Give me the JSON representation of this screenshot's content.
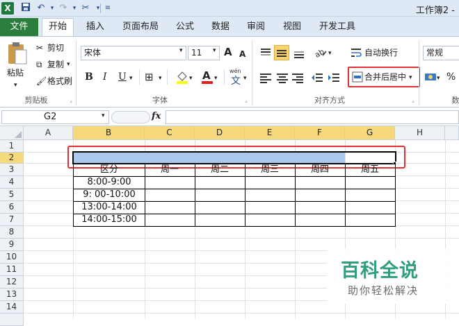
{
  "window": {
    "title": "工作簿2 -"
  },
  "quick_access": {
    "icons": [
      "excel-icon",
      "save-icon",
      "undo-icon",
      "redo-icon",
      "tools-icon"
    ]
  },
  "tabs": [
    {
      "label": "文件"
    },
    {
      "label": "开始"
    },
    {
      "label": "插入"
    },
    {
      "label": "页面布局"
    },
    {
      "label": "公式"
    },
    {
      "label": "数据"
    },
    {
      "label": "审阅"
    },
    {
      "label": "视图"
    },
    {
      "label": "开发工具"
    }
  ],
  "ribbon": {
    "clipboard": {
      "paste": "粘贴",
      "cut": "剪切",
      "copy": "复制",
      "format_painter": "格式刷",
      "label": "剪贴板"
    },
    "font": {
      "name": "宋体",
      "size": "11",
      "bold": "B",
      "italic": "I",
      "underline": "U",
      "grow": "A",
      "shrink": "A",
      "wen": "wén",
      "wen_char": "文",
      "label": "字体",
      "font_color_letter": "A"
    },
    "alignment": {
      "wrap_text": "自动换行",
      "merge_center": "合并后居中",
      "label": "对齐方式"
    },
    "number": {
      "format": "常规",
      "label": "数",
      "percent": "%"
    }
  },
  "formula_bar": {
    "name_box": "G2",
    "fx": "fx",
    "content": ""
  },
  "grid": {
    "columns": [
      "A",
      "B",
      "C",
      "D",
      "E",
      "F",
      "G",
      "H"
    ],
    "rows": [
      "1",
      "2",
      "3",
      "4",
      "5",
      "6",
      "7",
      "8",
      "9",
      "10",
      "11",
      "12",
      "13",
      "14"
    ],
    "header_row": [
      "区分",
      "周一",
      "周二",
      "周三",
      "周四",
      "周五"
    ],
    "time_slots": [
      "8:00-9:00",
      "9: 00-10:00",
      "13:00-14:00",
      "14:00-15:00"
    ]
  },
  "watermark": {
    "title": "百科全说",
    "subtitle": "助你轻松解决"
  },
  "colors": {
    "accent_green": "#2a7d3a",
    "highlight_red": "#e03030",
    "selection_blue": "#a9c8ec",
    "header_selected": "#f6d97c"
  }
}
